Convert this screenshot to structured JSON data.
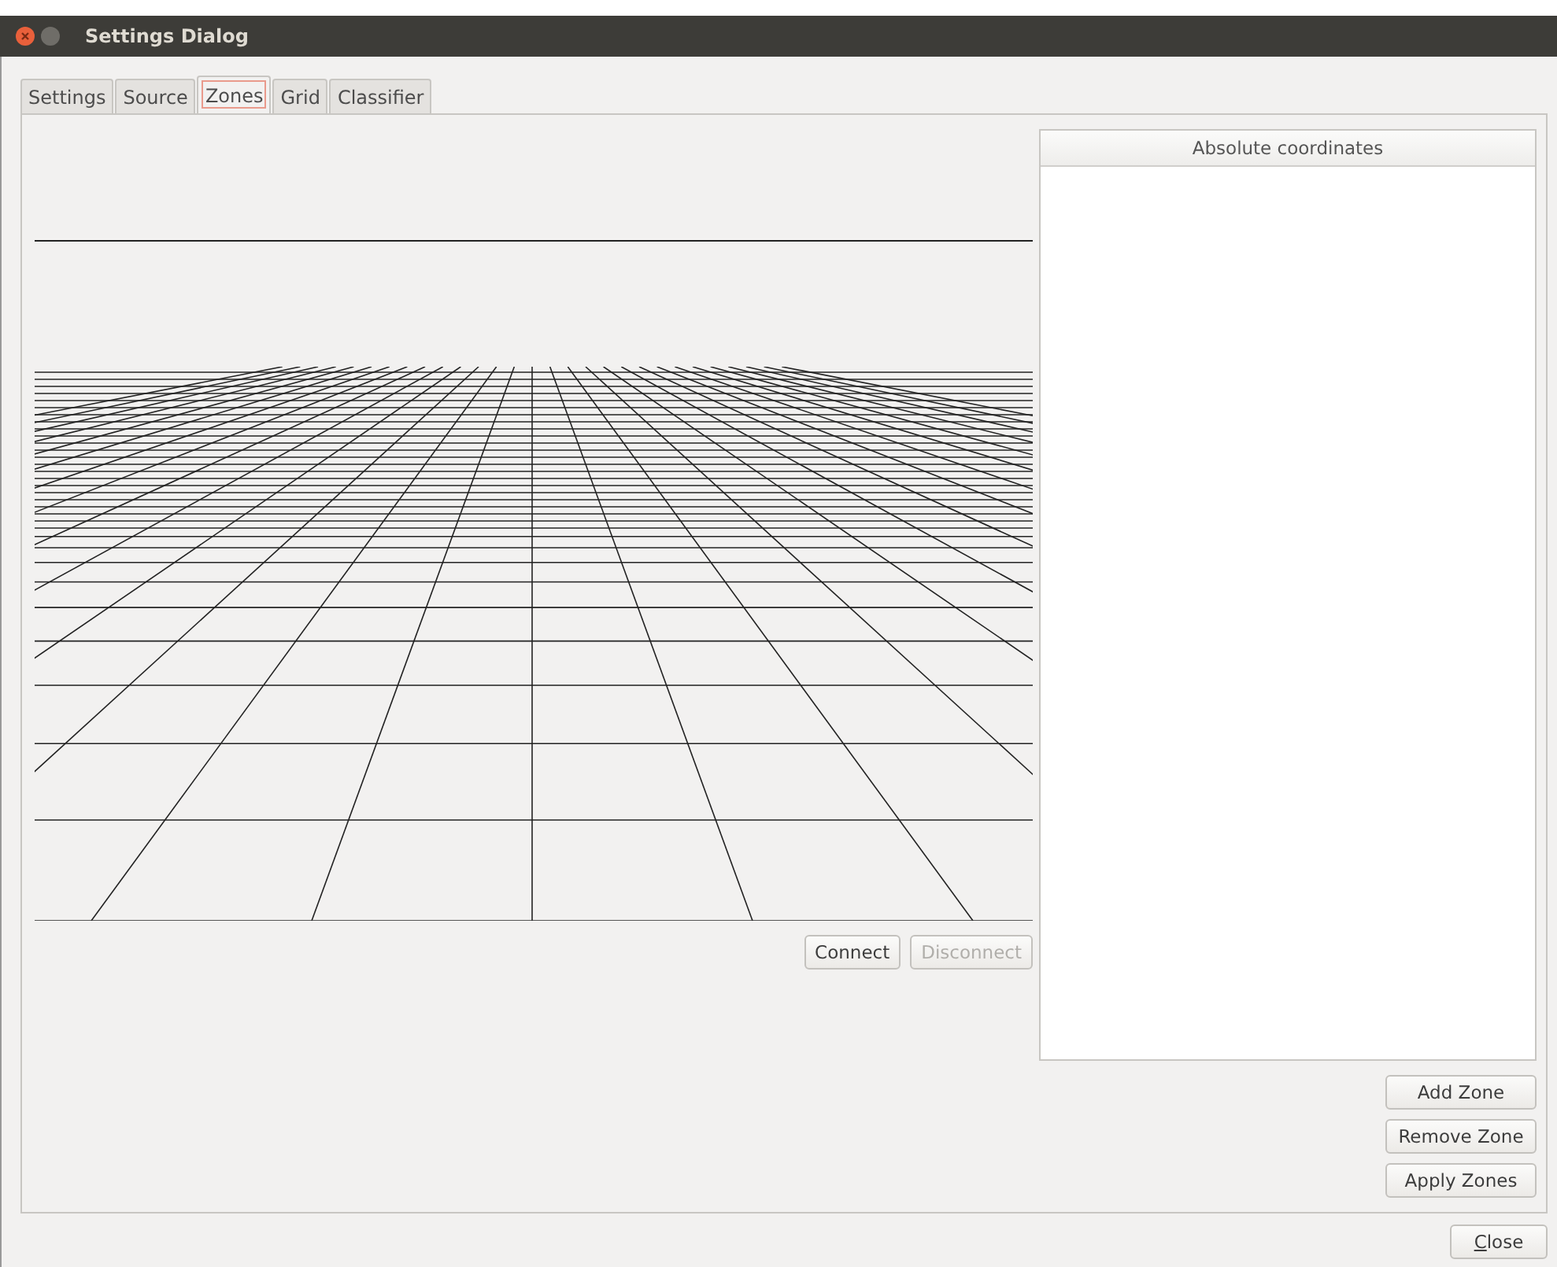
{
  "window": {
    "title": "Settings Dialog"
  },
  "tabs": [
    {
      "label": "Settings",
      "selected": false
    },
    {
      "label": "Source",
      "selected": false
    },
    {
      "label": "Zones",
      "selected": true
    },
    {
      "label": "Grid",
      "selected": false
    },
    {
      "label": "Classifier",
      "selected": false
    }
  ],
  "preview": {
    "buttons": [
      {
        "label": "Connect",
        "disabled": false
      },
      {
        "label": "Disconnect",
        "disabled": true
      }
    ]
  },
  "table": {
    "columns": [
      "Absolute coordinates"
    ]
  },
  "zone_buttons": [
    "Add Zone",
    "Remove Zone",
    "Apply Zones"
  ],
  "footer_button": "Close"
}
